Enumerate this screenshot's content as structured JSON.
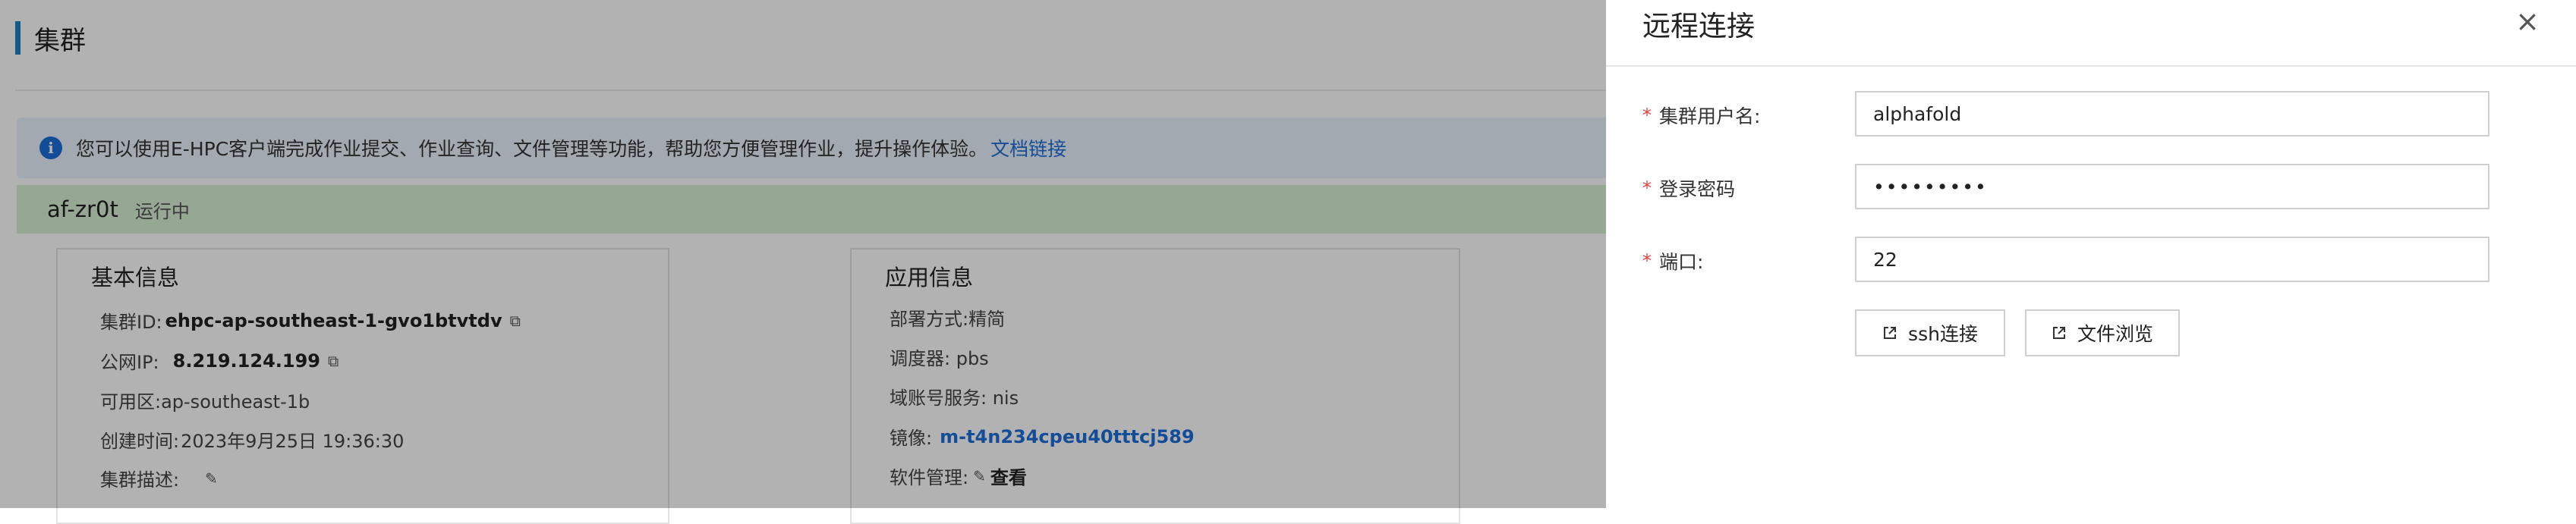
{
  "page": {
    "title": "集群",
    "banner": {
      "text": "您可以使用E-HPC客户端完成作业提交、作业查询、文件管理等功能，帮助您方便管理作业，提升操作体验。",
      "link": "文档链接"
    },
    "cluster": {
      "name": "af-zr0t",
      "status": "运行中"
    },
    "basic_info": {
      "heading": "基本信息",
      "cluster_id_label": "集群ID:",
      "cluster_id": "ehpc-ap-southeast-1-gvo1btvtdv",
      "public_ip_label": "公网IP:",
      "public_ip": "8.219.124.199",
      "zone": "可用区:ap-southeast-1b",
      "created_label": "创建时间:",
      "created": "2023年9月25日 19:36:30",
      "desc_label": "集群描述:"
    },
    "app_info": {
      "heading": "应用信息",
      "deploy": "部署方式:精简",
      "scheduler": "调度器: pbs",
      "account": "域账号服务: nis",
      "image_label": "镜像:",
      "image": "m-t4n234cpeu40tttcj589",
      "software_label": "软件管理:",
      "software_view": "查看"
    }
  },
  "drawer": {
    "title": "远程连接",
    "close": "×",
    "fields": {
      "username_label": "集群用户名:",
      "username": "alphafold",
      "password_label": "登录密码",
      "password": "•••••••••",
      "port_label": "端口:",
      "port": "22"
    },
    "buttons": {
      "ssh": "ssh连接",
      "files": "文件浏览"
    }
  },
  "colors": {
    "accent": "#1e80c8",
    "link": "#1e6fd9",
    "required": "#e8413c",
    "status_bg": "#d7f1d5",
    "banner_bg": "#e9f2fd"
  }
}
